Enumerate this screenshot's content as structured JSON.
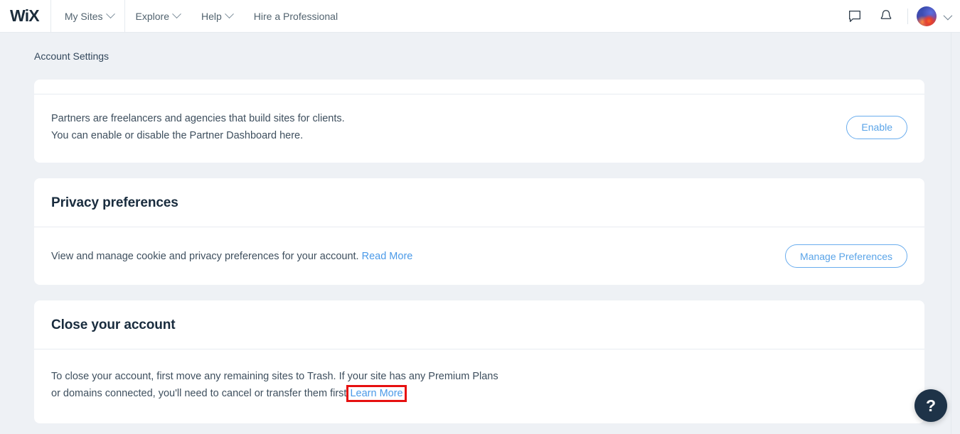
{
  "topbar": {
    "logo": "WiX",
    "nav": [
      {
        "label": "My Sites",
        "has_chevron": true
      },
      {
        "label": "Explore",
        "has_chevron": true
      },
      {
        "label": "Help",
        "has_chevron": true
      },
      {
        "label": "Hire a Professional",
        "has_chevron": false
      }
    ],
    "icons": {
      "chat": "chat-bubble-icon",
      "notifications": "bell-icon",
      "avatar": "user-avatar",
      "account_chevron": "chevron-down-icon"
    }
  },
  "subheader": {
    "title": "Account Settings"
  },
  "cards": {
    "partners": {
      "text_line1": "Partners are freelancers and agencies that build sites for clients.",
      "text_line2": "You can enable or disable the Partner Dashboard here.",
      "button_label": "Enable"
    },
    "privacy": {
      "title": "Privacy preferences",
      "text": "View and manage cookie and privacy preferences for your account.",
      "link_label": "Read More",
      "button_label": "Manage Preferences"
    },
    "close_account": {
      "title": "Close your account",
      "text_line1": "To close your account, first move any remaining sites to Trash. If your site has any Premium Plans",
      "text_line2": "or domains connected, you'll need to cancel or transfer them first.",
      "link_label": "Learn More"
    }
  },
  "help": {
    "label": "?"
  },
  "colors": {
    "page_background": "#eef1f5",
    "card_background": "#ffffff",
    "accent_blue": "#5aa4e8",
    "link_blue": "#4b9ae8",
    "heading": "#192c3e",
    "highlight_red": "#e61010",
    "help_fab": "#1e3348"
  }
}
